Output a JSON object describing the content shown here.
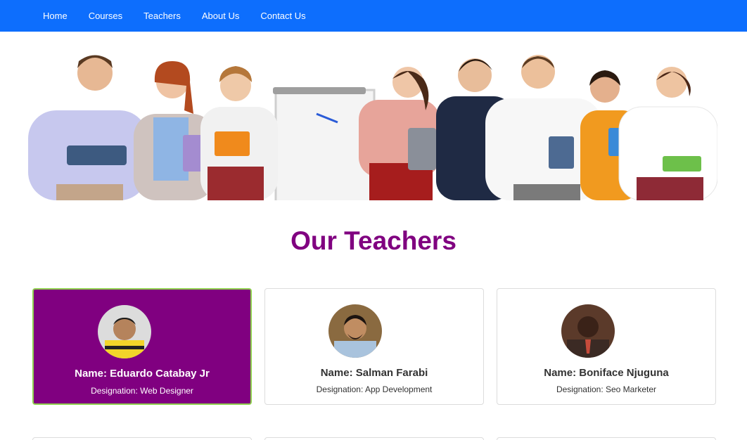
{
  "nav": {
    "items": [
      "Home",
      "Courses",
      "Teachers",
      "About Us",
      "Contact Us"
    ],
    "bg_color": "#0d6efd"
  },
  "hero": {
    "alt": "group of teachers banner"
  },
  "section": {
    "title": "Our Teachers",
    "title_color": "#800080"
  },
  "teachers": [
    {
      "name": "Name: Eduardo Catabay Jr",
      "designation": "Designation: Web Designer",
      "active": true
    },
    {
      "name": "Name: Salman Farabi",
      "designation": "Designation: App Development",
      "active": false
    },
    {
      "name": "Name: Boniface Njuguna",
      "designation": "Designation: Seo Marketer",
      "active": false
    }
  ],
  "colors": {
    "active_card": "#800080",
    "active_border": "#8fd14f"
  }
}
